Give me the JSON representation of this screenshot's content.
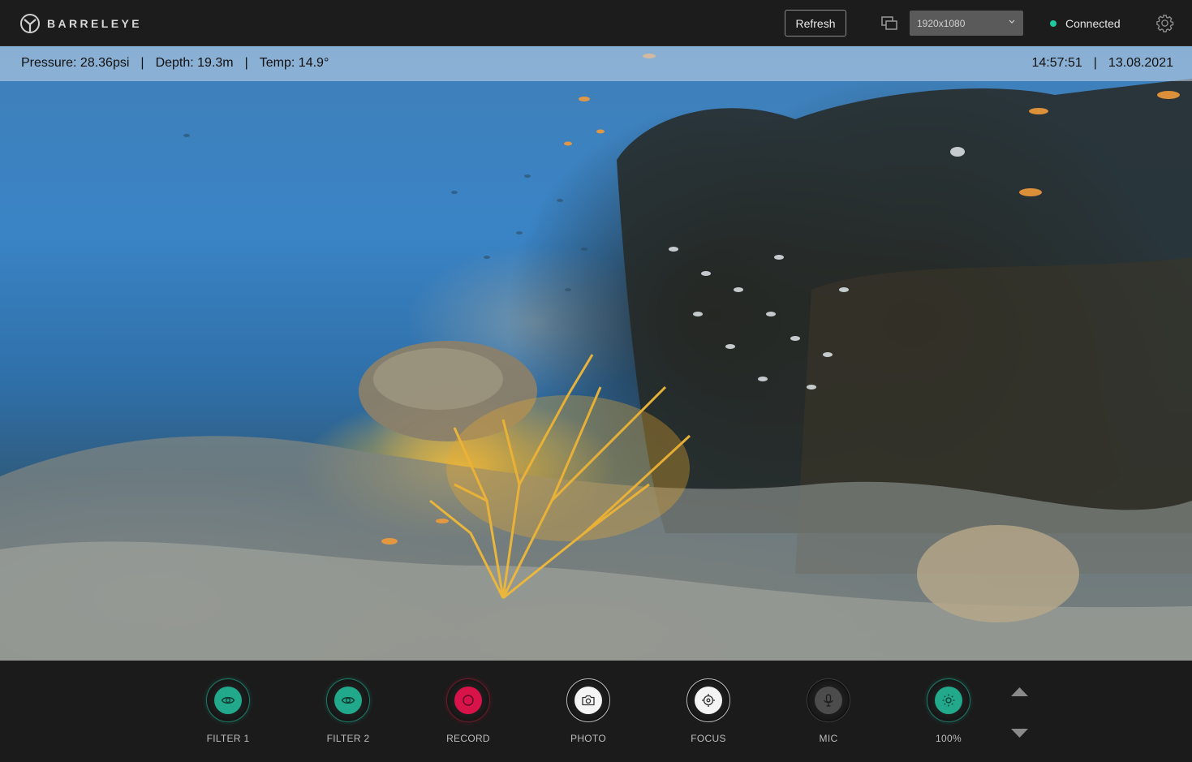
{
  "app": {
    "brand": "BARRELEYE"
  },
  "header": {
    "refresh_label": "Refresh",
    "resolution": "1920x1080",
    "status": "Connected",
    "status_color": "#1ec9a0"
  },
  "telemetry": {
    "pressure": "Pressure: 28.36psi",
    "depth": "Depth: 19.3m",
    "temp": "Temp: 14.9°",
    "separator": "|",
    "time": "14:57:51",
    "date": "13.08.2021"
  },
  "controls": [
    {
      "label": "FILTER 1",
      "icon": "eye-icon",
      "style": "teal"
    },
    {
      "label": "FILTER 2",
      "icon": "eye-icon",
      "style": "teal"
    },
    {
      "label": "RECORD",
      "icon": "record-icon",
      "style": "red"
    },
    {
      "label": "PHOTO",
      "icon": "camera-icon",
      "style": "white"
    },
    {
      "label": "FOCUS",
      "icon": "crosshair-icon",
      "style": "white"
    },
    {
      "label": "MIC",
      "icon": "mic-icon",
      "style": "grey"
    },
    {
      "label": "100%",
      "icon": "brightness-icon",
      "style": "teal"
    }
  ],
  "colors": {
    "accent": "#22a98c",
    "record": "#d8134a",
    "background": "#1b1b1b"
  }
}
